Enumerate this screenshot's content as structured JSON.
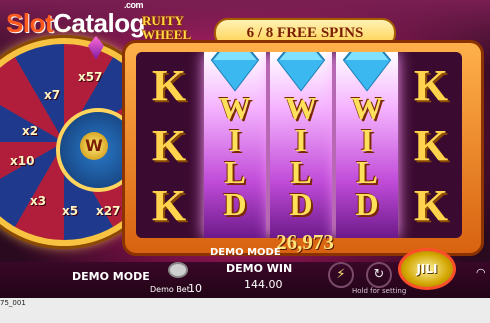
{
  "watermark": {
    "slot": "Slot",
    "catalog": "Catalog",
    "com": ".com"
  },
  "game_logo": {
    "line1": "RUITY",
    "line2": "WHEEL"
  },
  "free_spins": {
    "label": "6 / 8 FREE SPINS"
  },
  "wheel": {
    "labels": [
      "x57",
      "x7",
      "x2",
      "x10",
      "x3",
      "x5",
      "x27"
    ],
    "center": "W"
  },
  "reels": {
    "left_symbols": [
      "K",
      "K",
      "K"
    ],
    "right_symbols": [
      "K",
      "K",
      "K"
    ],
    "wild_letters": [
      "W",
      "I",
      "L",
      "D"
    ]
  },
  "win_amount": "26,973",
  "demo_mode_top": "DEMO MODE",
  "bottom": {
    "demo_mode": "DEMO MODE",
    "demo_bet_label": "Demo Bet",
    "demo_bet_value": "10",
    "demo_win_label": "DEMO WIN",
    "demo_win_value": "144.00",
    "hold_text": "Hold for setting",
    "spin_label": "JILI"
  },
  "footer_id": "75_001",
  "colors": {
    "accent": "#ffd34d",
    "banner": "#ffd04a",
    "wild": "#c04bd8"
  }
}
